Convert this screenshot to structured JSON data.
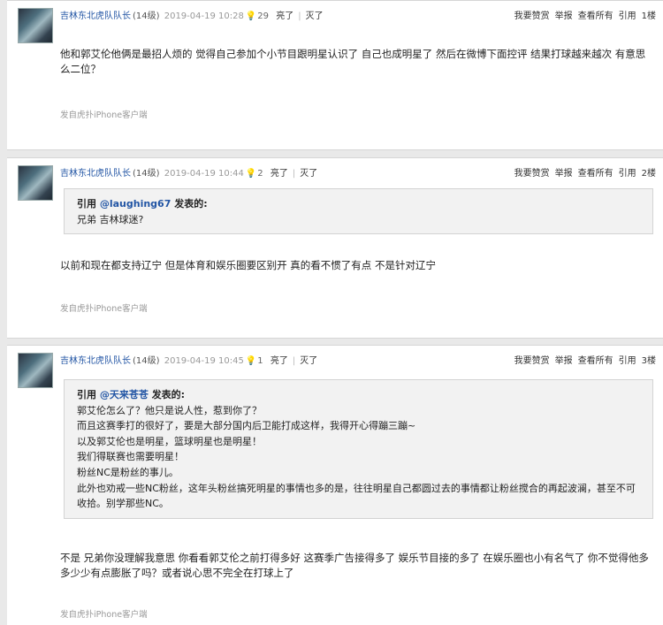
{
  "actions": {
    "reward": "我要赞赏",
    "report": "举报",
    "view_all": "查看所有",
    "quote": "引用"
  },
  "quote_labels": {
    "quote": "引用",
    "posted": "发表的:"
  },
  "posts": [
    {
      "user": "吉林东北虎队队长",
      "level": "(14级)",
      "time": "2019-04-19 10:28",
      "light_count": "29",
      "light": "亮了",
      "dim": "灭了",
      "floor": "1楼",
      "content": "他和郭艾伦他俩是最招人烦的 觉得自己参加个小节目跟明星认识了 自己也成明星了 然后在微博下面控评 结果打球越来越次 有意思么二位？",
      "source": "发自虎扑iPhone客户端"
    },
    {
      "user": "吉林东北虎队队长",
      "level": "(14级)",
      "time": "2019-04-19 10:44",
      "light_count": "2",
      "light": "亮了",
      "dim": "灭了",
      "floor": "2楼",
      "quote_user": "@laughing67",
      "quote_lines": [
        "兄弟 吉林球迷?"
      ],
      "content": "以前和现在都支持辽宁 但是体育和娱乐圈要区别开 真的看不惯了有点 不是针对辽宁",
      "source": "发自虎扑iPhone客户端"
    },
    {
      "user": "吉林东北虎队队长",
      "level": "(14级)",
      "time": "2019-04-19 10:45",
      "light_count": "1",
      "light": "亮了",
      "dim": "灭了",
      "floor": "3楼",
      "quote_user": "@天来苍苍",
      "quote_lines": [
        "郭艾伦怎么了？他只是说人性，惹到你了？",
        "而且这赛季打的很好了，要是大部分国内后卫能打成这样，我得开心得蹦三蹦~",
        "以及郭艾伦也是明星，篮球明星也是明星！",
        "我们得联赛也需要明星！",
        "粉丝NC是粉丝的事儿。",
        "此外也劝戒一些NC粉丝，这年头粉丝搞死明星的事情也多的是，往往明星自己都圆过去的事情都让粉丝搅合的再起波澜，甚至不可收拾。别学那些NC。"
      ],
      "content": "不是 兄弟你没理解我意思 你看看郭艾伦之前打得多好 这赛季广告接得多了 娱乐节目接的多了 在娱乐圈也小有名气了 你不觉得他多多少少有点膨胀了吗？或者说心思不完全在打球上了",
      "source": "发自虎扑iPhone客户端"
    }
  ]
}
